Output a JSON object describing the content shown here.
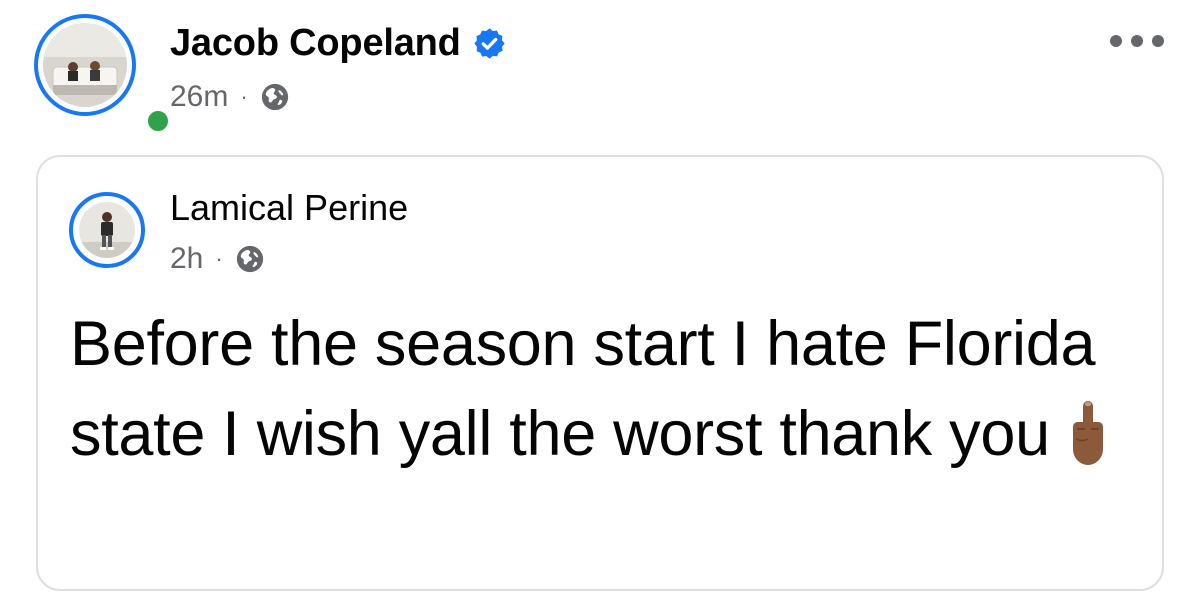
{
  "post": {
    "author": "Jacob Copeland",
    "verified": true,
    "time": "26m",
    "separator": "·",
    "audience_icon": "globe-icon",
    "status_color": "#31a24c",
    "accent_color": "#1877f2"
  },
  "shared_post": {
    "author": "Lamical Perine",
    "time": "2h",
    "separator": "·",
    "audience_icon": "globe-icon",
    "text": "Before the season start I hate Florida state I wish yall the worst thank you",
    "emoji": "middle-finger-icon"
  },
  "actions": {
    "more_icon": "more-options-icon"
  }
}
